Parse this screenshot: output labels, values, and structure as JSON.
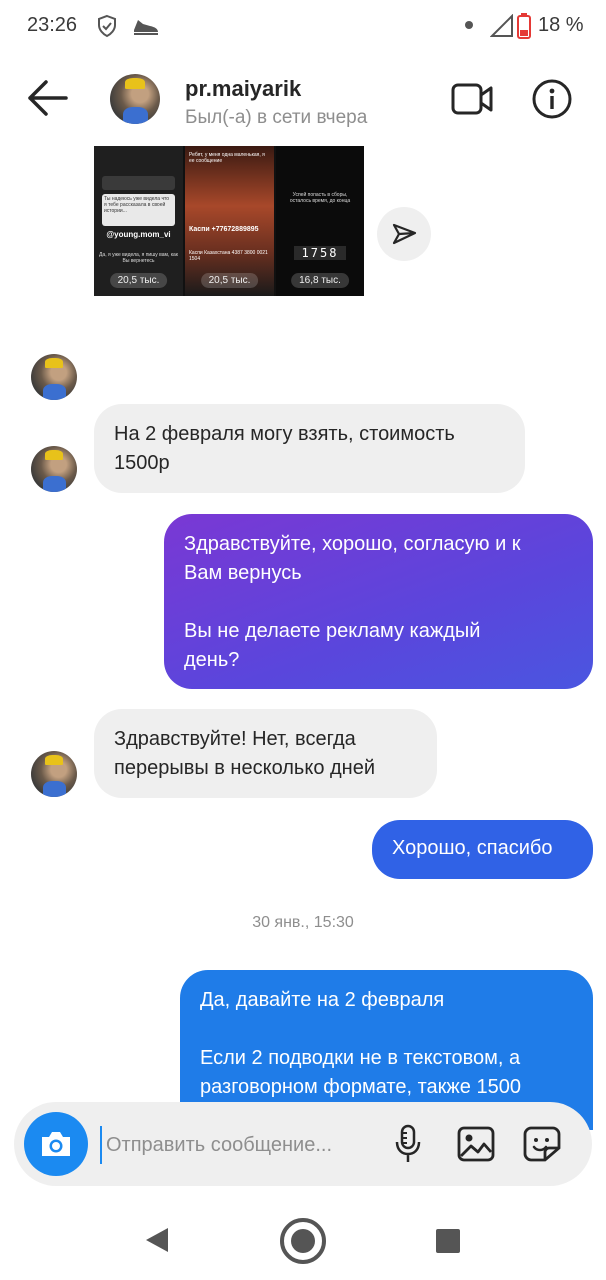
{
  "status_bar": {
    "time": "23:26",
    "battery": "18 %"
  },
  "header": {
    "username": "pr.maiyarik",
    "status": "Был(-а) в сети вчера"
  },
  "shared_post": {
    "thumbs": [
      {
        "top_text": "Ты надеюсь уже видела что я тебе рассказала в своей истории...",
        "handle": "@young.mom_vi",
        "bottom_text": "Да, я уже видела, я пишу вам, как Вы вернетесь",
        "views": "20,5 тыс."
      },
      {
        "top_text": "Ребят, у меня одна маленькая, я ее сообщение",
        "handle": "Каспи +77672889895",
        "bottom_text": "Каспи Казахстана 4387 3800 0021 1504",
        "views": "20,5 тыс."
      },
      {
        "top_text": "Успей попасть в сборы, осталось время, до конца",
        "handle": "1758",
        "bottom_text": "",
        "views": "16,8 тыс."
      }
    ]
  },
  "messages": [
    {
      "id": "m1",
      "text": "На 2 февраля могу взять, стоимость\n1500р"
    },
    {
      "id": "m2",
      "text": "Здравствуйте, хорошо, согласую и к\nВам вернусь\n\nВы не делаете рекламу каждый\nдень?"
    },
    {
      "id": "m3",
      "text": "Здравствуйте! Нет, всегда\nперерывы в несколько дней"
    },
    {
      "id": "m4",
      "text": "Хорошо, спасибо"
    },
    {
      "id": "m5",
      "text": "Да, давайте на 2 февраля\n\nЕсли 2 подводки не в текстовом, а\nразговорном формате, также 1500"
    }
  ],
  "date_separator": "30 янв., 15:30",
  "composer": {
    "placeholder": "Отправить сообщение..."
  },
  "colors": {
    "accent": "#1b8af1",
    "purple_bubble": "#6a3fd8",
    "blue_bubble": "#3062e6",
    "incoming_bubble": "#efefef"
  }
}
